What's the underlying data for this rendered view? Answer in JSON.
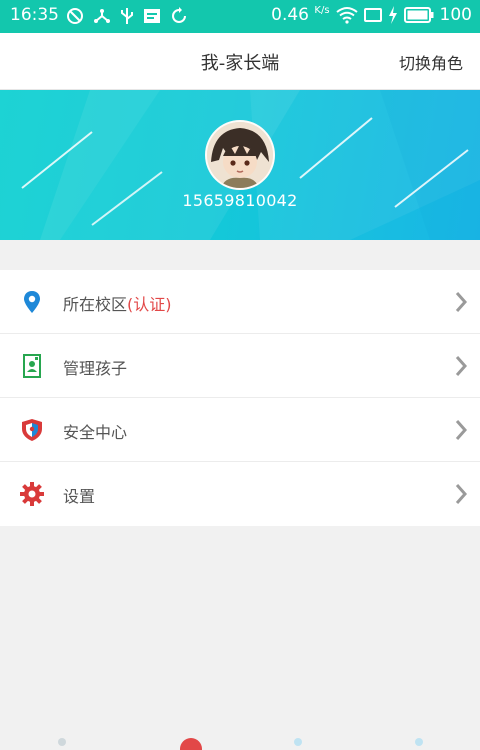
{
  "status_bar": {
    "time": "16:35",
    "net_speed": "0.46",
    "net_unit": "K/s",
    "battery": "100"
  },
  "nav": {
    "title": "我-家长端",
    "switch_role": "切换角色"
  },
  "profile": {
    "phone": "15659810042"
  },
  "menu": {
    "items": [
      {
        "label": "所在校区",
        "suffix": "(认证)",
        "icon": "location-pin-icon"
      },
      {
        "label": "管理孩子",
        "icon": "child-card-icon"
      },
      {
        "label": "安全中心",
        "icon": "shield-icon"
      },
      {
        "label": "设置",
        "icon": "gear-icon"
      }
    ]
  },
  "colors": {
    "status_bar": "#13c7ad",
    "banner_start": "#0fd1d2",
    "banner_end": "#1ab6e6",
    "accent_red": "#e24848"
  }
}
